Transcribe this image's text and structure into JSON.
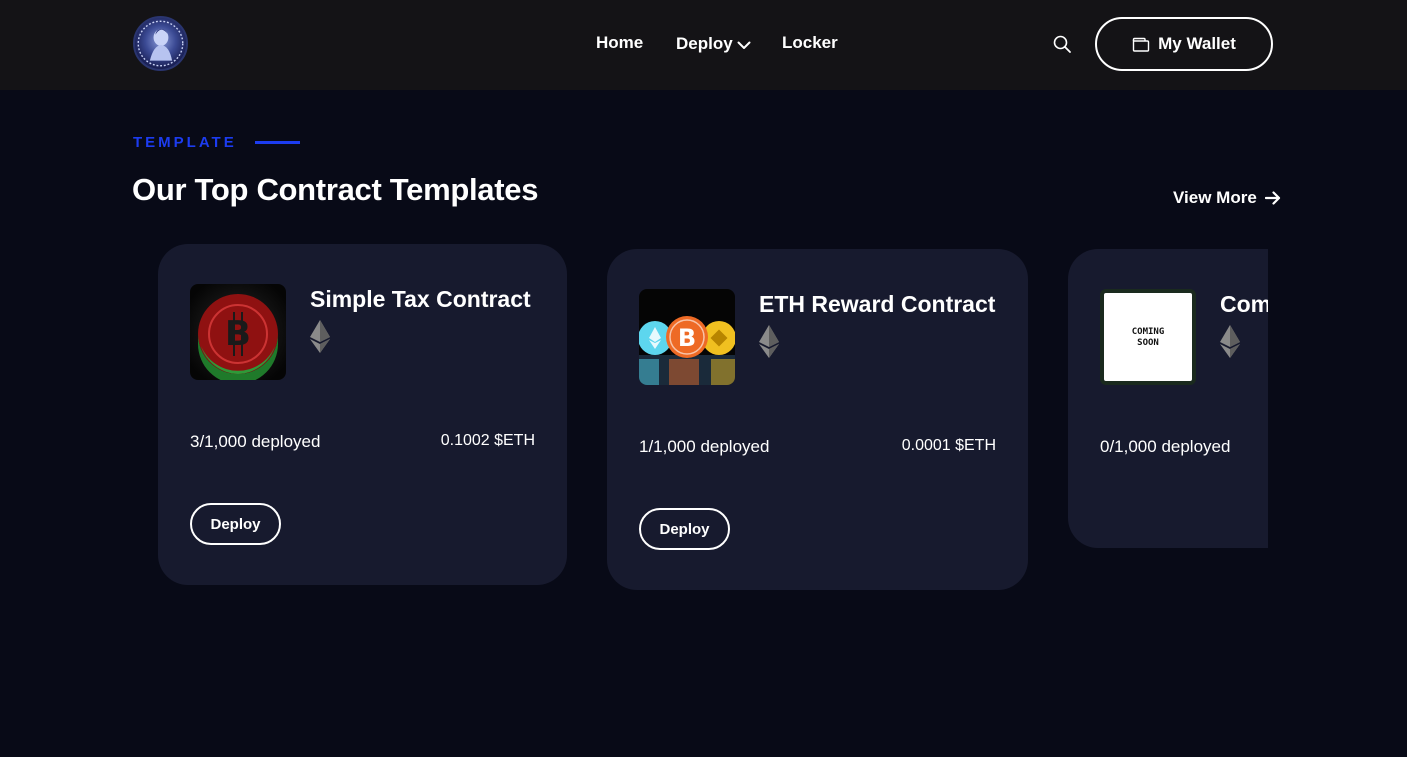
{
  "header": {
    "nav": {
      "home": "Home",
      "deploy": "Deploy",
      "locker": "Locker"
    },
    "wallet_label": "My Wallet"
  },
  "section": {
    "eyebrow": "TEMPLATE",
    "title": "Our Top Contract Templates",
    "view_more": "View More"
  },
  "cards": [
    {
      "title": "Simple Tax Contract",
      "deployed": "3/1,000 deployed",
      "price": "0.1002 $ETH",
      "button": "Deploy",
      "image": "bitcoin-coin-image"
    },
    {
      "title": "ETH Reward Contract",
      "deployed": "1/1,000 deployed",
      "price": "0.0001 $ETH",
      "button": "Deploy",
      "image": "crypto-coins-image"
    },
    {
      "title": "Com",
      "deployed": "0/1,000 deployed",
      "image_text": "COMING SOON",
      "image": "coming-soon-image"
    }
  ],
  "colors": {
    "accent": "#1c3cf0",
    "background": "#080a17",
    "card": "#171a2e",
    "topbar": "#141316"
  }
}
